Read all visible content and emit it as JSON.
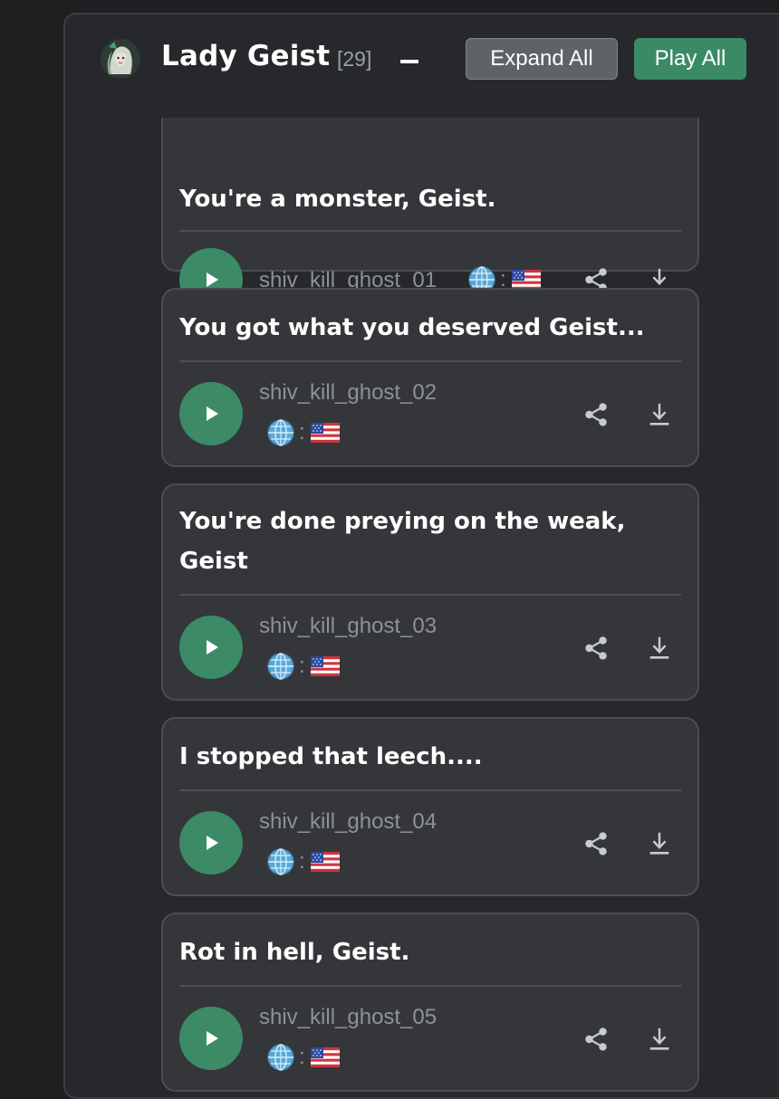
{
  "header": {
    "title": "Lady Geist",
    "count": "[29]",
    "expand_label": "Expand All",
    "play_label": "Play All"
  },
  "colors": {
    "background": "#1e1f21",
    "panel": "#26282b",
    "card": "#34363a",
    "accent_green": "#3c8a66",
    "muted_text": "#8e9297"
  },
  "lines": [
    {
      "text": "You're a monster, Geist.",
      "clip": "shiv_kill_ghost_01",
      "colon": ":"
    },
    {
      "text": "You got what you deserved Geist...",
      "clip": "shiv_kill_ghost_02",
      "colon": ":"
    },
    {
      "text": "You're done preying on the weak, Geist",
      "clip": "shiv_kill_ghost_03",
      "colon": ":"
    },
    {
      "text": "I stopped that leech....",
      "clip": "shiv_kill_ghost_04",
      "colon": ":"
    },
    {
      "text": "Rot in hell, Geist.",
      "clip": "shiv_kill_ghost_05",
      "colon": ":"
    }
  ],
  "icons": {
    "avatar": "character-portrait-icon",
    "play": "play-icon",
    "language": "globe-icon",
    "flag": "us-flag-icon",
    "share": "share-icon",
    "download": "download-icon"
  }
}
